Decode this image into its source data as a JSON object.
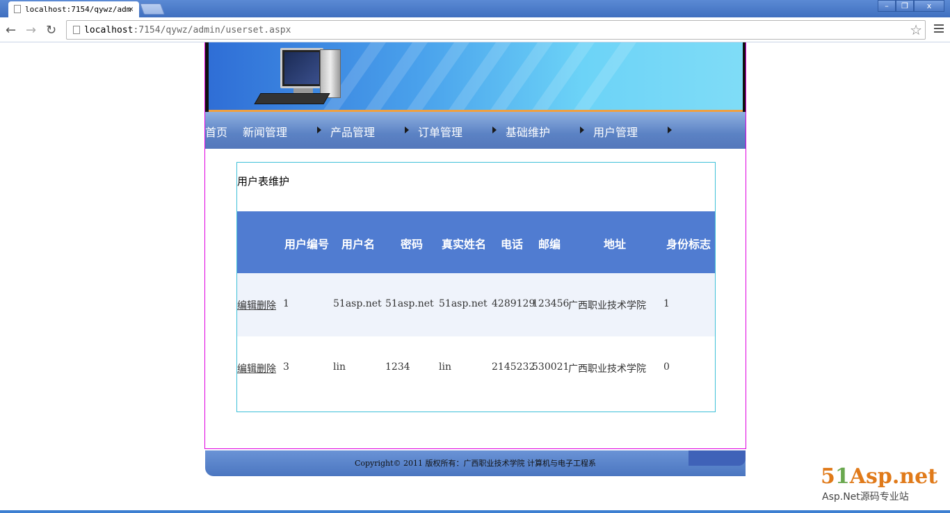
{
  "browser": {
    "tab_title": "localhost:7154/qywz/adm",
    "tab_close": "×",
    "url_host": "localhost",
    "url_rest": ":7154/qywz/admin/userset.aspx",
    "back": "←",
    "forward": "→",
    "reload": "↻",
    "star": "☆",
    "minimize": "–",
    "maximize": "❐",
    "close": "x"
  },
  "nav": {
    "items": [
      {
        "label": "首页"
      },
      {
        "label": "新闻管理"
      },
      {
        "label": "产品管理"
      },
      {
        "label": "订单管理"
      },
      {
        "label": "基础维护"
      },
      {
        "label": "用户管理"
      }
    ]
  },
  "content": {
    "title": "用户表维护",
    "columns": [
      "用户编号",
      "用户名",
      "密码",
      "真实姓名",
      "电话",
      "邮编",
      "地址",
      "身份标志"
    ],
    "rows": [
      {
        "edit": "编辑",
        "delete": "删除",
        "id": "1",
        "username": "51asp.net",
        "password": "51asp.net",
        "realname": "51asp.net",
        "phone": "4289129",
        "zip": "123456",
        "address": "广西职业技术学院",
        "flag": "1"
      },
      {
        "edit": "编辑",
        "delete": "删除",
        "id": "3",
        "username": "lin",
        "password": "1234",
        "realname": "lin",
        "phone": "2145232",
        "zip": "530021",
        "address": "广西职业技术学院",
        "flag": "0"
      }
    ]
  },
  "footer": {
    "text": "Copyright© 2011 版权所有：广西职业技术学院 计算机与电子工程系"
  },
  "watermark": {
    "logo_a": "5",
    "logo_one": "1",
    "logo_b": "Asp.net",
    "sub": "Asp.Net源码专业站"
  },
  "colors": {
    "accent": "#507cd1",
    "alt_row": "#eff3fb",
    "page_border": "#e000e0",
    "box_border": "#3ec0d8"
  }
}
